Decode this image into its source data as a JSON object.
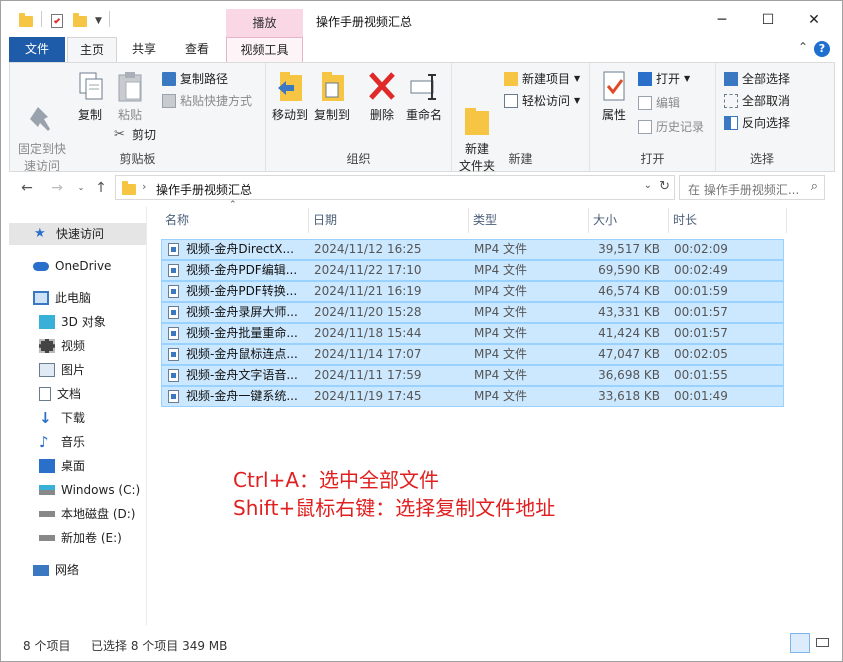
{
  "window": {
    "title": "操作手册视频汇总",
    "context_tab_header": "播放",
    "minimize": "─",
    "maximize": "☐",
    "close": "✕"
  },
  "tabs": {
    "file": "文件",
    "home": "主页",
    "share": "共享",
    "view": "查看",
    "video_tools": "视频工具"
  },
  "ribbon": {
    "clipboard": {
      "label": "剪贴板",
      "pin": "固定到快\n速访问",
      "copy": "复制",
      "paste": "粘贴",
      "copy_path": "复制路径",
      "paste_shortcut": "粘贴快捷方式",
      "cut": "剪切"
    },
    "organize": {
      "label": "组织",
      "move_to": "移动到",
      "copy_to": "复制到",
      "delete": "删除",
      "rename": "重命名"
    },
    "new": {
      "label": "新建",
      "new_folder": "新建\n文件夹",
      "new_item": "新建项目",
      "easy_access": "轻松访问"
    },
    "open": {
      "label": "打开",
      "properties": "属性",
      "open": "打开",
      "edit": "编辑",
      "history": "历史记录"
    },
    "select": {
      "label": "选择",
      "select_all": "全部选择",
      "select_none": "全部取消",
      "invert": "反向选择"
    }
  },
  "address": {
    "path": "操作手册视频汇总",
    "search_placeholder": "在 操作手册视频汇..."
  },
  "nav": {
    "quick_access": "快速访问",
    "onedrive": "OneDrive",
    "this_pc": "此电脑",
    "objects3d": "3D 对象",
    "videos": "视频",
    "pictures": "图片",
    "documents": "文档",
    "downloads": "下载",
    "music": "音乐",
    "desktop": "桌面",
    "drive_c": "Windows (C:)",
    "drive_d": "本地磁盘 (D:)",
    "drive_e": "新加卷 (E:)",
    "network": "网络"
  },
  "columns": {
    "name": "名称",
    "date": "日期",
    "type": "类型",
    "size": "大小",
    "duration": "时长"
  },
  "files": [
    {
      "name": "视频-金舟DirectX...",
      "date": "2024/11/12 16:25",
      "type": "MP4 文件",
      "size": "39,517 KB",
      "duration": "00:02:09"
    },
    {
      "name": "视频-金舟PDF编辑...",
      "date": "2024/11/22 17:10",
      "type": "MP4 文件",
      "size": "69,590 KB",
      "duration": "00:02:49"
    },
    {
      "name": "视频-金舟PDF转换...",
      "date": "2024/11/21 16:19",
      "type": "MP4 文件",
      "size": "46,574 KB",
      "duration": "00:01:59"
    },
    {
      "name": "视频-金舟录屏大师...",
      "date": "2024/11/20 15:28",
      "type": "MP4 文件",
      "size": "43,331 KB",
      "duration": "00:01:57"
    },
    {
      "name": "视频-金舟批量重命...",
      "date": "2024/11/18 15:44",
      "type": "MP4 文件",
      "size": "41,424 KB",
      "duration": "00:01:57"
    },
    {
      "name": "视频-金舟鼠标连点...",
      "date": "2024/11/14 17:07",
      "type": "MP4 文件",
      "size": "47,047 KB",
      "duration": "00:02:05"
    },
    {
      "name": "视频-金舟文字语音...",
      "date": "2024/11/11 17:59",
      "type": "MP4 文件",
      "size": "36,698 KB",
      "duration": "00:01:55"
    },
    {
      "name": "视频-金舟一键系统...",
      "date": "2024/11/19 17:45",
      "type": "MP4 文件",
      "size": "33,618 KB",
      "duration": "00:01:49"
    }
  ],
  "annotations": {
    "line1": "Ctrl+A：选中全部文件",
    "line2": "Shift+鼠标右键：选择复制文件地址"
  },
  "status": {
    "count": "8 个项目",
    "selected": "已选择 8 个项目  349 MB"
  },
  "colors": {
    "selection_bg": "#cce8ff",
    "selection_border": "#99d1ff",
    "file_tab": "#1e5ba8",
    "annotation": "#e02020"
  }
}
